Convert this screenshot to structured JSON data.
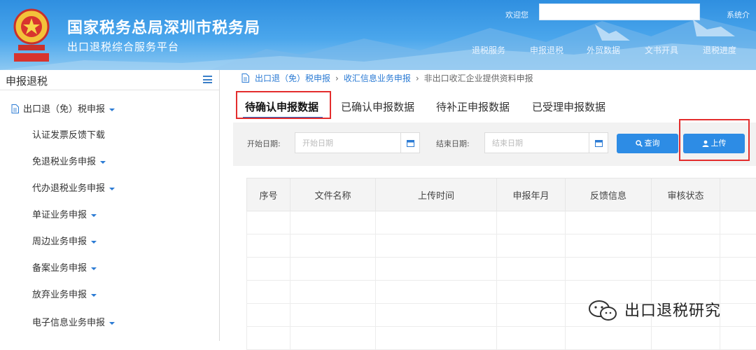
{
  "header": {
    "title": "国家税务总局深圳市税务局",
    "subtitle": "出口退税综合服务平台",
    "welcome_label": "欢迎您",
    "right_text": "系统介",
    "nav": [
      "退税服务",
      "申报退税",
      "外贸数据",
      "文书开具",
      "退税进度"
    ]
  },
  "sidebar": {
    "title": "申报退税",
    "top_item": "出口退（免）税申报",
    "items": [
      "认证发票反馈下载",
      "免退税业务申报",
      "代办退税业务申报",
      "单证业务申报",
      "周边业务申报",
      "备案业务申报",
      "放弃业务申报",
      "电子信息业务申报"
    ]
  },
  "breadcrumb": [
    "出口退（免）税申报",
    "收汇信息业务申报",
    "非出口收汇企业提供资料申报"
  ],
  "tabs": [
    "待确认申报数据",
    "已确认申报数据",
    "待补正申报数据",
    "已受理申报数据"
  ],
  "filter": {
    "start_label": "开始日期:",
    "start_placeholder": "开始日期",
    "end_label": "结束日期:",
    "end_placeholder": "结束日期",
    "query_label": "查询",
    "upload_label": "上传"
  },
  "table": {
    "columns": [
      "序号",
      "文件名称",
      "上传时间",
      "申报年月",
      "反馈信息",
      "审核状态",
      ""
    ]
  },
  "watermark": "出口退税研究",
  "colors": {
    "primary": "#2d8ce5",
    "highlight_red": "#e32d2d",
    "header_blue": "#3a97e4"
  }
}
